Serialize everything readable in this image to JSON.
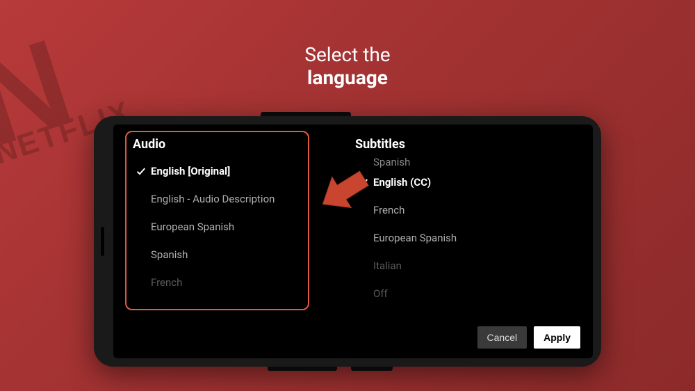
{
  "header": {
    "line1": "Select the",
    "line2": "language"
  },
  "bg": {
    "brand_letter": "N",
    "brand_text": "NETFLIX"
  },
  "audio": {
    "title": "Audio",
    "options": [
      {
        "label": "English [Original]",
        "selected": true
      },
      {
        "label": "English - Audio Description",
        "selected": false
      },
      {
        "label": "European Spanish",
        "selected": false
      },
      {
        "label": "Spanish",
        "selected": false
      },
      {
        "label": "French",
        "selected": false,
        "faded": true
      }
    ]
  },
  "subtitles": {
    "title": "Subtitles",
    "partial_top": "Spanish",
    "options": [
      {
        "label": "English (CC)",
        "selected": true
      },
      {
        "label": "French",
        "selected": false
      },
      {
        "label": "European Spanish",
        "selected": false
      },
      {
        "label": "Italian",
        "selected": false,
        "faded": true
      },
      {
        "label": "Off",
        "selected": false,
        "faded": true
      }
    ]
  },
  "buttons": {
    "cancel": "Cancel",
    "apply": "Apply"
  }
}
